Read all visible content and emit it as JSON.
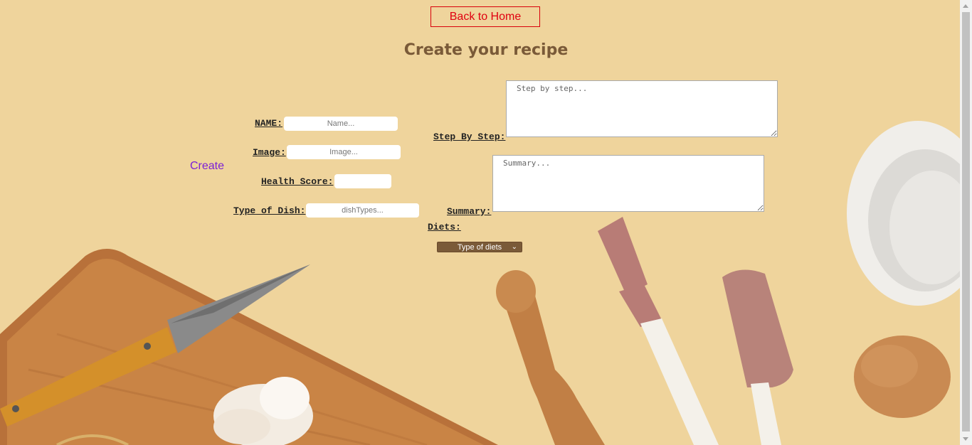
{
  "nav": {
    "back_label": "Back to Home"
  },
  "page": {
    "title": "Create your recipe"
  },
  "form": {
    "create_label": "Create",
    "name": {
      "label": "NAME:",
      "placeholder": "Name..."
    },
    "image": {
      "label": "Image:",
      "placeholder": "Image..."
    },
    "health_score": {
      "label": "Health Score:",
      "placeholder": ""
    },
    "dish_type": {
      "label": "Type of Dish:",
      "placeholder": "dishTypes..."
    },
    "steps": {
      "label": "Step By Step:",
      "placeholder": "Step by step..."
    },
    "summary": {
      "label": "Summary:",
      "placeholder": "Summary..."
    },
    "diets": {
      "label": "Diets:",
      "selected": "Type of diets"
    }
  },
  "colors": {
    "background": "#efd49c",
    "accent_brown": "#7a5a38",
    "back_button": "#e00010",
    "create_link": "#7b1fd6"
  }
}
